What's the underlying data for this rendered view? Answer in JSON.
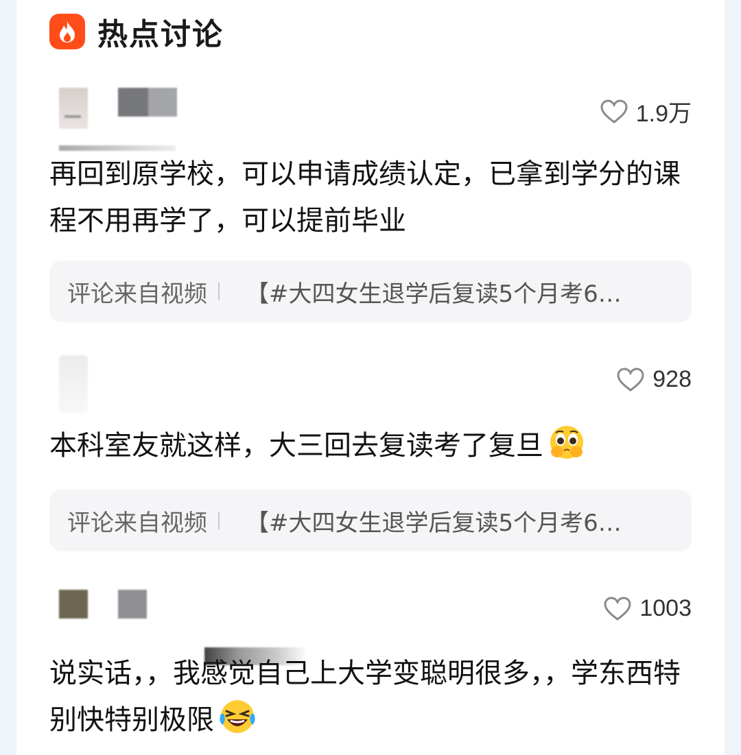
{
  "header": {
    "title": "热点讨论",
    "icon": "fire-icon",
    "accent": "#ff4d1a"
  },
  "comments": [
    {
      "likes": "1.9万",
      "text": "再回到原学校，可以申请成绩认定，已拿到学分的课程不用再学了，可以提前毕业",
      "source_label": "评论来自视频",
      "source_ref": "【#大四女生退学后复读5个月考6…"
    },
    {
      "likes": "928",
      "text": "本科室友就这样，大三回去复读考了复旦",
      "emoji": "crying-pleading-emoji",
      "source_label": "评论来自视频",
      "source_ref": "【#大四女生退学后复读5个月考6…"
    },
    {
      "likes": "1003",
      "text": "说实话，，我感觉自己上大学变聪明很多，，学东西特别快特别极限",
      "emoji": "laughing-crying-emoji"
    }
  ],
  "colors": {
    "background": "#eef4f8",
    "card": "#ffffff",
    "source_box": "#f5f5f7",
    "like_icon": "#8a8a8a"
  }
}
